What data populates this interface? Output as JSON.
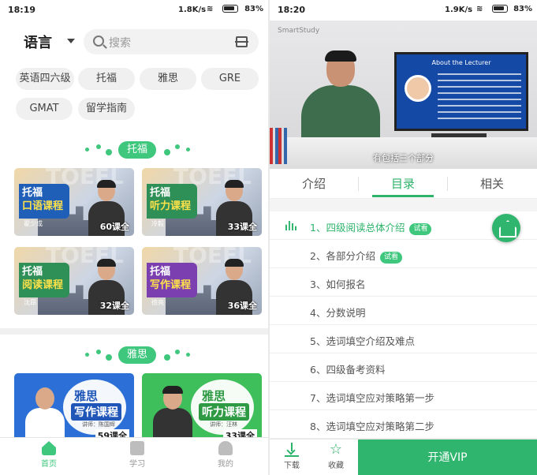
{
  "left": {
    "status": {
      "time": "18:19",
      "rate": "1.8K/s",
      "battery": "83%"
    },
    "header": {
      "language": "语言",
      "search_placeholder": "搜索"
    },
    "chips": [
      "英语四六级",
      "托福",
      "雅思",
      "GRE",
      "GMAT",
      "留学指南"
    ],
    "section_toefl": "托福",
    "toefl_cards": [
      {
        "line1": "托福",
        "line2": "口语课程",
        "teacher": "翟少成",
        "count": "60课全",
        "color": "#1f5fb8"
      },
      {
        "line1": "托福",
        "line2": "听力课程",
        "teacher": "冷毅",
        "count": "33课全",
        "color": "#2e8f57"
      },
      {
        "line1": "托福",
        "line2": "阅读课程",
        "teacher": "沈昂",
        "count": "32课全",
        "color": "#2e8f57"
      },
      {
        "line1": "托福",
        "line2": "写作课程",
        "teacher": "徐亮",
        "count": "36课全",
        "color": "#7b3fb0"
      }
    ],
    "section_ielts": "雅思",
    "ielts_cards": [
      {
        "t1": "雅思",
        "t2": "写作课程",
        "teacher": "讲师：陈国辉",
        "count": "59课全",
        "bg": "#2c6fd6",
        "accent": "#1f56b8"
      },
      {
        "t1": "雅思",
        "t2": "听力课程",
        "teacher": "讲师：汪林",
        "count": "33课全",
        "bg": "#3fbf5b",
        "accent": "#2e9a44"
      }
    ],
    "tabs": [
      "首页",
      "学习",
      "我的"
    ]
  },
  "right": {
    "status": {
      "time": "18:20",
      "rate": "1.9K/s",
      "battery": "83%"
    },
    "video": {
      "watermark": "SmartStudy",
      "slide_title": "About the Lecturer",
      "caption": "有包括三个部分"
    },
    "tabs": [
      "介绍",
      "目录",
      "相关"
    ],
    "lessons": [
      {
        "label": "1、四级阅读总体介绍",
        "trial": "试看"
      },
      {
        "label": "2、各部分介绍",
        "trial": "试看"
      },
      {
        "label": "3、如何报名",
        "trial": ""
      },
      {
        "label": "4、分数说明",
        "trial": ""
      },
      {
        "label": "5、选词填空介绍及难点",
        "trial": ""
      },
      {
        "label": "6、四级备考资料",
        "trial": ""
      },
      {
        "label": "7、选词填空应对策略第一步",
        "trial": ""
      },
      {
        "label": "8、选词填空应对策略第二步",
        "trial": ""
      }
    ],
    "bottom": {
      "download": "下载",
      "favorite": "收藏",
      "vip": "开通VIP"
    }
  },
  "colors": {
    "accent": "#3ec77d",
    "accent_dark": "#2db36a"
  }
}
